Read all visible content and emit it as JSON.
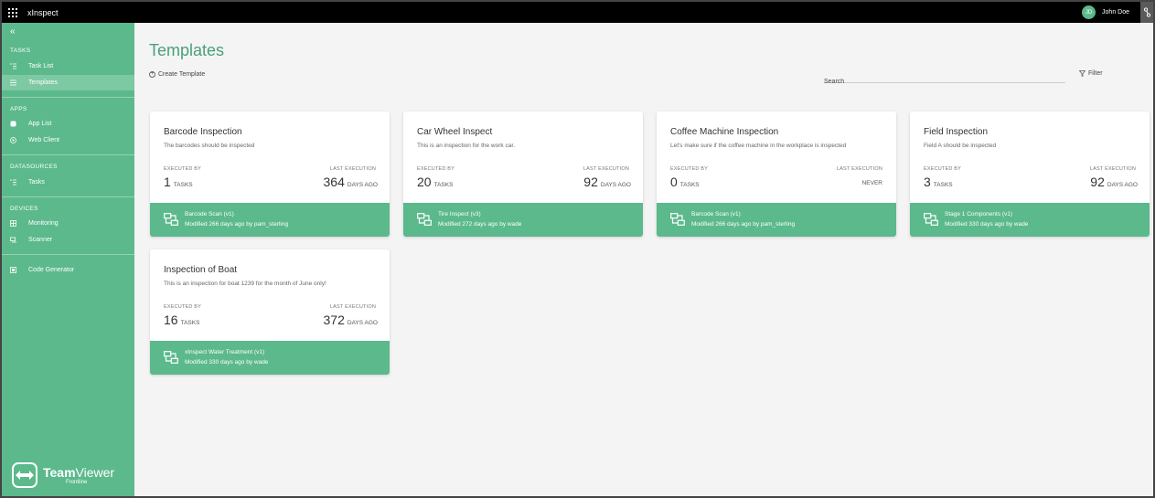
{
  "app": {
    "title": "xInspect"
  },
  "user": {
    "initials": "JD",
    "name": "John Doe"
  },
  "sidebar": {
    "sections": [
      {
        "label": "TASKS"
      },
      {
        "label": "APPS"
      },
      {
        "label": "DATASOURCES"
      },
      {
        "label": "DEVICES"
      }
    ],
    "items": [
      {
        "label": "Task List",
        "icon": "task-list-icon"
      },
      {
        "label": "Templates",
        "icon": "list-icon",
        "active": true
      },
      {
        "label": "App List",
        "icon": "app-list-icon"
      },
      {
        "label": "Web Client",
        "icon": "play-circle-icon"
      },
      {
        "label": "Tasks",
        "icon": "task-list-icon"
      },
      {
        "label": "Monitoring",
        "icon": "monitoring-icon"
      },
      {
        "label": "Scanner",
        "icon": "scanner-icon"
      },
      {
        "label": "Code Generator",
        "icon": "code-generator-icon"
      }
    ],
    "brand": {
      "name_bold": "Team",
      "name_light": "Viewer",
      "sub": "Frontline"
    }
  },
  "main": {
    "title": "Templates",
    "create_label": "Create Template",
    "search_placeholder": "Search",
    "filter_label": "Filter",
    "stat_labels": {
      "executed": "EXECUTED BY",
      "last": "LAST EXECUTION",
      "tasks_unit": "TASKS",
      "days_unit": "DAYS AGO"
    },
    "cards": [
      {
        "title": "Barcode Inspection",
        "desc": "The barcodes should be inspected",
        "executed": "1",
        "last": "364",
        "app": "Barcode Scan (v1)",
        "modified": "Modified 266 days ago by pam_sterling"
      },
      {
        "title": "Car Wheel Inspect",
        "desc": "This is an inspection for the work car.",
        "executed": "20",
        "last": "92",
        "app": "Tire Inspect (v3)",
        "modified": "Modified 272 days ago by wade"
      },
      {
        "title": "Coffee Machine Inspection",
        "desc": "Let's make sure if the coffee machine in the workplace is inspected",
        "executed": "0",
        "last_text": "NEVER",
        "app": "Barcode Scan (v1)",
        "modified": "Modified 266 days ago by pam_sterling"
      },
      {
        "title": "Field Inspection",
        "desc": "Field A should be inspected",
        "executed": "3",
        "last": "92",
        "app": "Stage 1 Components (v1)",
        "modified": "Modified 330 days ago by wade"
      },
      {
        "title": "Inspection of Boat",
        "desc": "This is an inspection for boat 1239 for the month of June only!",
        "executed": "16",
        "last": "372",
        "app": "xInspect Water Treatment (v1)",
        "modified": "Modified 330 days ago by wade"
      }
    ]
  },
  "colors": {
    "accent": "#5bb98c",
    "active": "#7cc9a3",
    "title": "#4aa07a"
  }
}
